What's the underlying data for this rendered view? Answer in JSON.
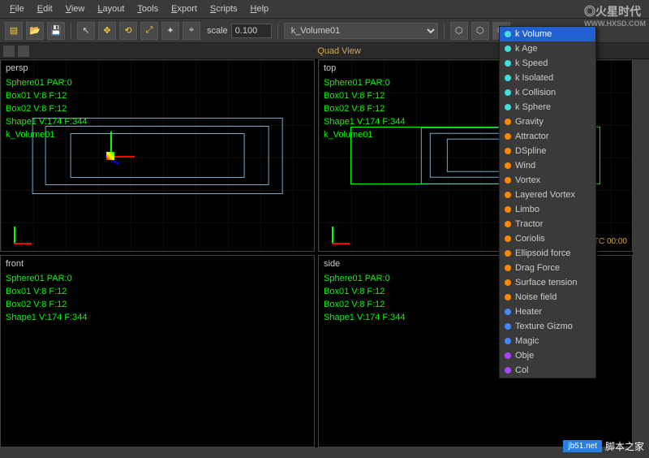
{
  "menu": {
    "items": [
      "File",
      "Edit",
      "View",
      "Layout",
      "Tools",
      "Export",
      "Scripts",
      "Help"
    ]
  },
  "toolbar": {
    "scale_label": "scale",
    "scale_value": "0.100",
    "object_selected": "k_Volume01"
  },
  "tabbar": {
    "title": "Quad View"
  },
  "viewports": {
    "persp": {
      "name": "persp",
      "lines": [
        "Sphere01 PAR:0",
        "Box01 V:8 F:12",
        "Box02 V:8 F:12",
        "Shape1 V:174 F:344",
        "k_Volume01"
      ]
    },
    "top": {
      "name": "top",
      "lines": [
        "Sphere01 PAR:0",
        "Box01 V:8 F:12",
        "Box02 V:8 F:12",
        "Shape1 V:174 F:344",
        "k_Volume01"
      ],
      "readout": "TC                  00:00"
    },
    "front": {
      "name": "front",
      "lines": [
        "Sphere01 PAR:0",
        "Box01 V:8 F:12",
        "Box02 V:8 F:12",
        "Shape1 V:174 F:344"
      ]
    },
    "side": {
      "name": "side",
      "lines": [
        "Sphere01 PAR:0",
        "Box01 V:8 F:12",
        "Box02 V:8 F:12",
        "Shape1 V:174 F:344"
      ]
    }
  },
  "dropdown": {
    "selected": "k Volume",
    "items": [
      {
        "label": "k Volume",
        "color": "cyan",
        "sel": true
      },
      {
        "label": "k Age",
        "color": "cyan"
      },
      {
        "label": "k Speed",
        "color": "cyan"
      },
      {
        "label": "k Isolated",
        "color": "cyan"
      },
      {
        "label": "k Collision",
        "color": "cyan"
      },
      {
        "label": "k Sphere",
        "color": "cyan"
      },
      {
        "label": "Gravity",
        "color": "orange"
      },
      {
        "label": "Attractor",
        "color": "orange"
      },
      {
        "label": "DSpline",
        "color": "orange"
      },
      {
        "label": "Wind",
        "color": "orange"
      },
      {
        "label": "Vortex",
        "color": "orange"
      },
      {
        "label": "Layered Vortex",
        "color": "orange"
      },
      {
        "label": "Limbo",
        "color": "orange"
      },
      {
        "label": "Tractor",
        "color": "orange"
      },
      {
        "label": "Coriolis",
        "color": "orange"
      },
      {
        "label": "Ellipsoid force",
        "color": "orange"
      },
      {
        "label": "Drag Force",
        "color": "orange"
      },
      {
        "label": "Surface tension",
        "color": "orange"
      },
      {
        "label": "Noise field",
        "color": "orange"
      },
      {
        "label": "Heater",
        "color": "blue"
      },
      {
        "label": "Texture Gizmo",
        "color": "blue"
      },
      {
        "label": "Magic",
        "color": "blue"
      },
      {
        "label": "Obje",
        "color": "purple"
      },
      {
        "label": "Col",
        "color": "purple"
      }
    ]
  },
  "watermark": {
    "main": "◎火星时代",
    "sub": "WWW.HXSD.COM"
  },
  "watermark2": {
    "badge": "jb51.net",
    "text": "脚本之家"
  }
}
